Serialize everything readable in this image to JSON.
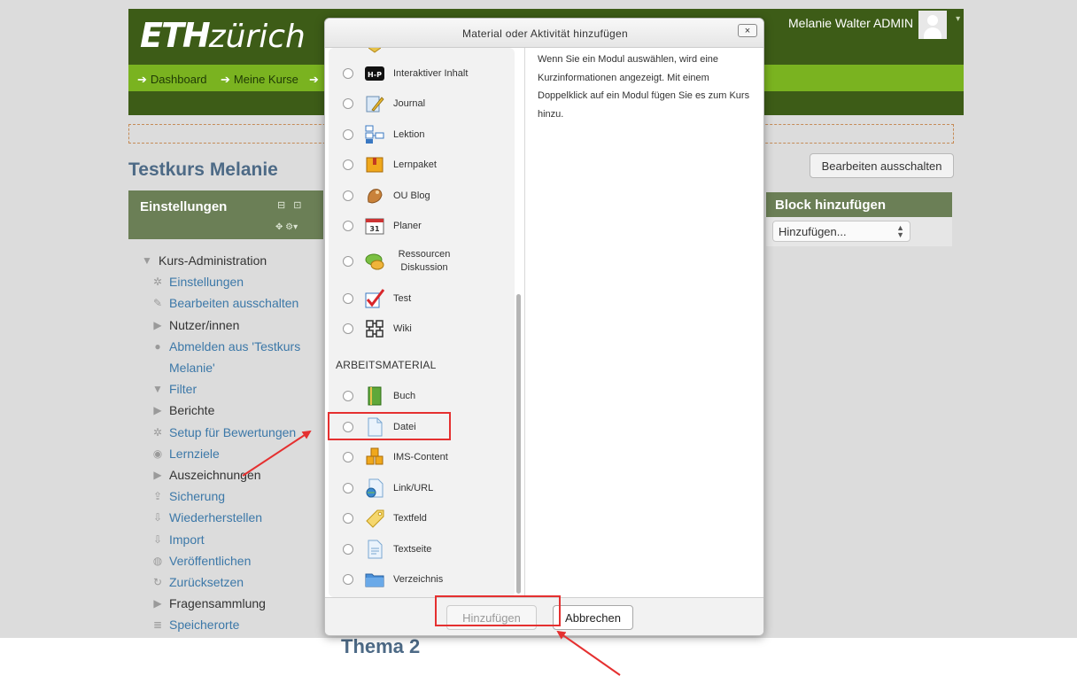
{
  "header": {
    "logo_bold": "ETH",
    "logo_light": "zürich",
    "user_name": "Melanie Walter ADMIN"
  },
  "breadcrumb": {
    "items": [
      "Dashboard",
      "Meine Kurse"
    ]
  },
  "course": {
    "title": "Testkurs Melanie",
    "edit_button": "Bearbeiten ausschalten",
    "behind_heading": "Thema 2"
  },
  "settings_block": {
    "title": "Einstellungen",
    "items": [
      {
        "label": "Kurs-Administration",
        "icon": "caret-down-icon"
      },
      {
        "label": "Einstellungen",
        "icon": "gear-icon"
      },
      {
        "label": "Bearbeiten ausschalten",
        "icon": "pencil-icon"
      },
      {
        "label": "Nutzer/innen",
        "icon": "caret-right-icon"
      },
      {
        "label": "Abmelden aus 'Testkurs",
        "icon": "user-icon"
      },
      {
        "label": "Melanie'",
        "icon": ""
      },
      {
        "label": "Filter",
        "icon": "filter-icon"
      },
      {
        "label": "Berichte",
        "icon": "caret-right-icon"
      },
      {
        "label": "Setup für Bewertungen",
        "icon": "gear-icon"
      },
      {
        "label": "Lernziele",
        "icon": "target-icon"
      },
      {
        "label": "Auszeichnungen",
        "icon": "caret-right-icon"
      },
      {
        "label": "Sicherung",
        "icon": "upload-icon"
      },
      {
        "label": "Wiederherstellen",
        "icon": "download-icon"
      },
      {
        "label": "Import",
        "icon": "download-icon"
      },
      {
        "label": "Veröffentlichen",
        "icon": "globe-icon"
      },
      {
        "label": "Zurücksetzen",
        "icon": "reset-icon"
      },
      {
        "label": "Fragensammlung",
        "icon": "caret-right-icon"
      },
      {
        "label": "Speicherorte",
        "icon": "storage-icon"
      }
    ]
  },
  "add_block": {
    "title": "Block hinzufügen",
    "select_value": "Hinzufügen..."
  },
  "dialog": {
    "title": "Material oder Aktivität hinzufügen",
    "close_label": "×",
    "activities": [
      {
        "label": "Interaktiver Inhalt",
        "icon": "h5p-icon"
      },
      {
        "label": "Journal",
        "icon": "journal-icon"
      },
      {
        "label": "Lektion",
        "icon": "lesson-icon"
      },
      {
        "label": "Lernpaket",
        "icon": "package-icon"
      },
      {
        "label": "OU Blog",
        "icon": "blog-icon"
      },
      {
        "label": "Planer",
        "icon": "calendar-icon"
      },
      {
        "label": "Ressourcen Diskussion",
        "icon": "discussion-icon"
      },
      {
        "label": "Test",
        "icon": "quiz-icon"
      },
      {
        "label": "Wiki",
        "icon": "wiki-icon"
      }
    ],
    "resources_heading": "ARBEITSMATERIAL",
    "resources": [
      {
        "label": "Buch",
        "icon": "book-icon"
      },
      {
        "label": "Datei",
        "icon": "file-icon"
      },
      {
        "label": "IMS-Content",
        "icon": "ims-icon"
      },
      {
        "label": "Link/URL",
        "icon": "url-icon"
      },
      {
        "label": "Textfeld",
        "icon": "label-icon"
      },
      {
        "label": "Textseite",
        "icon": "page-icon"
      },
      {
        "label": "Verzeichnis",
        "icon": "folder-icon"
      }
    ],
    "info_text": "Wenn Sie ein Modul auswählen, wird eine Kurzinformationen angezeigt. Mit einem Doppelklick auf ein Modul fügen Sie es zum Kurs hinzu.",
    "add_button": "Hinzufügen",
    "cancel_button": "Abbrechen"
  },
  "colors": {
    "header_dark_green": "#3d5c17",
    "nav_light_green": "#7ab320",
    "block_green": "#6b7f56",
    "link_blue": "#3c78a8",
    "annotation_red": "#e53030"
  }
}
